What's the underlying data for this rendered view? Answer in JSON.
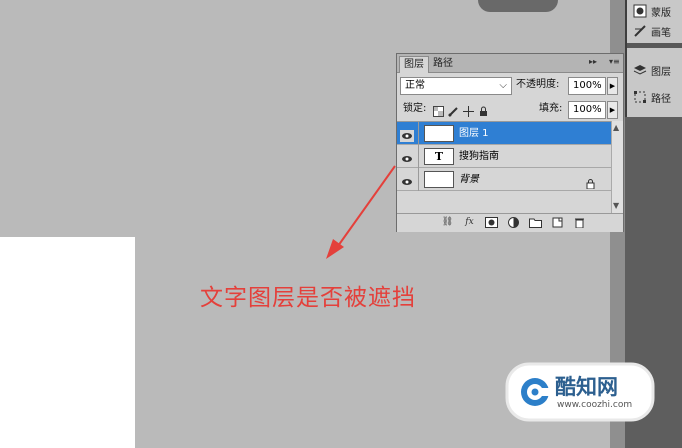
{
  "layers_panel": {
    "tabs": [
      "图层",
      "路径"
    ],
    "blend_mode": "正常",
    "opacity_label": "不透明度:",
    "opacity_value": "100%",
    "lock_label": "锁定:",
    "fill_label": "填充:",
    "fill_value": "100%",
    "layers": [
      {
        "name": "图层 1",
        "selected": true,
        "thumb": "white"
      },
      {
        "name": "搜狗指南",
        "selected": false,
        "thumb": "T"
      },
      {
        "name": "背景",
        "selected": false,
        "thumb": "white",
        "locked": true
      }
    ]
  },
  "right_dock": {
    "items": [
      "蒙版",
      "画笔",
      "图层",
      "路径"
    ]
  },
  "annotation": "文字图层是否被遮挡",
  "watermark": {
    "brand": "酷知网",
    "url": "www.coozhi.com"
  },
  "colors": {
    "selection": "#2f7fd3",
    "annotation": "#e4403b"
  }
}
